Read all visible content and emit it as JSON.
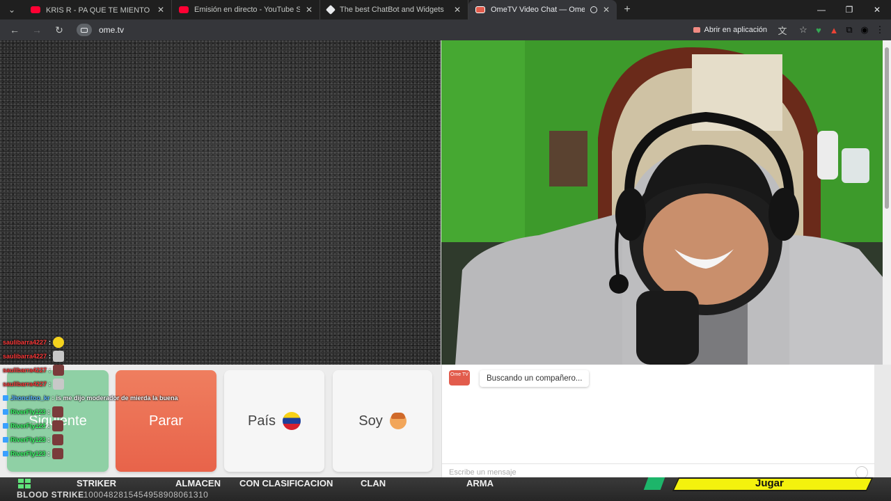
{
  "browser": {
    "tabs": [
      {
        "title": "KRIS R - PA QUE TE MIENTO 💕",
        "active": false,
        "favicon": "youtube-icon"
      },
      {
        "title": "Emisión en directo - YouTube St",
        "active": false,
        "favicon": "youtube-icon"
      },
      {
        "title": "The best ChatBot and Widgets",
        "active": false,
        "favicon": "chatbot-icon"
      },
      {
        "title": "OmeTV Video Chat — Ome",
        "active": true,
        "favicon": "ometv-icon"
      }
    ],
    "url": "ome.tv",
    "open_in_app_label": "Abrir en aplicación"
  },
  "controls": {
    "next_label": "Siguiente",
    "stop_label": "Parar",
    "country_label": "País",
    "gender_label": "Soy"
  },
  "chat": {
    "logo_text": "Ome TV",
    "status_message": "Buscando un compañero...",
    "input_placeholder": "Escribe un mensaje"
  },
  "overlay_chat": [
    {
      "user": "saulibarra4227",
      "sep": ":",
      "text": "",
      "emote": "yellow"
    },
    {
      "user": "saulibarra4227",
      "sep": ":",
      "text": "",
      "emote": "person"
    },
    {
      "user": "saulibarra4227",
      "sep": ":",
      "text": "",
      "emote": "face"
    },
    {
      "user": "saulibarra4227",
      "sep": ":",
      "text": "",
      "emote": "person"
    },
    {
      "user": "Jhoncitoo_kr",
      "sep": ":",
      "text": "is me dijo moderador de mierda la buena",
      "emote": ""
    },
    {
      "user": "RiverFly123",
      "sep": ":",
      "text": "",
      "emote": "face"
    },
    {
      "user": "RiverFly123",
      "sep": ":",
      "text": "",
      "emote": "face"
    },
    {
      "user": "RiverFly123",
      "sep": ":",
      "text": "",
      "emote": "face"
    },
    {
      "user": "RiverFly123",
      "sep": ":",
      "text": "",
      "emote": "face"
    }
  ],
  "hud": {
    "menu": [
      "STRIKER",
      "ALMACEN",
      "CON CLASIFICACION",
      "CLAN",
      "ARMA"
    ],
    "game_title": "BLOOD STRIKE",
    "game_id": "1000482815454958908061310",
    "play_label": "Jugar"
  },
  "colors": {
    "stop": "#e8634a",
    "next": "#8fd0a5",
    "ometv": "#e25c4c",
    "wall": "#3f9a2a"
  }
}
